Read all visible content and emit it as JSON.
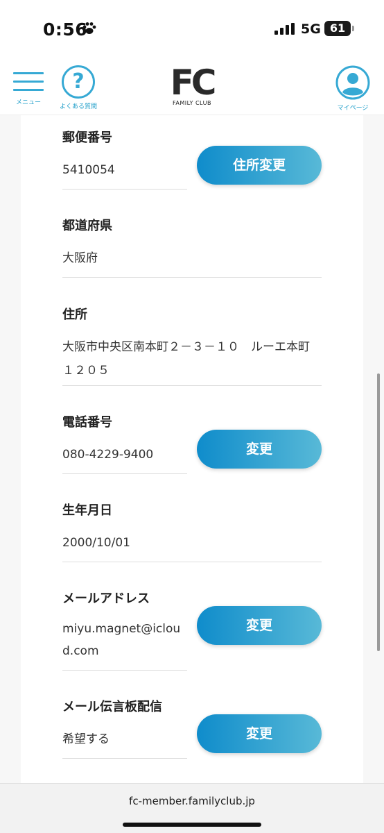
{
  "status_bar": {
    "time": "0:56",
    "network": "5G",
    "battery": "61",
    "time_icon": "paw-icon",
    "signal_icon": "signal-bars-icon"
  },
  "header": {
    "menu_label": "メニュー",
    "faq_label": "よくある質問",
    "faq_glyph": "?",
    "logo_mark": "FC",
    "logo_sub": "FAMILY CLUB",
    "mypage_label": "マイページ"
  },
  "fields": {
    "postal": {
      "label": "郵便番号",
      "value": "5410054",
      "button": "住所変更"
    },
    "prefecture": {
      "label": "都道府県",
      "value": "大阪府"
    },
    "address": {
      "label": "住所",
      "value": "大阪市中央区南本町２－３－１０　ルーエ本町　１２０５"
    },
    "phone": {
      "label": "電話番号",
      "value": "080-4229-9400",
      "button": "変更"
    },
    "birthdate": {
      "label": "生年月日",
      "value": "2000/10/01"
    },
    "email": {
      "label": "メールアドレス",
      "value": "miyu.magnet@icloud.com",
      "button": "変更"
    },
    "mail_board": {
      "label": "メール伝言板配信",
      "value": "希望する",
      "button": "変更"
    }
  },
  "browser": {
    "url": "fc-member.familyclub.jp"
  },
  "colors": {
    "accent": "#36a9d4",
    "button_start": "#0f8ccb",
    "button_end": "#58b9d7"
  }
}
